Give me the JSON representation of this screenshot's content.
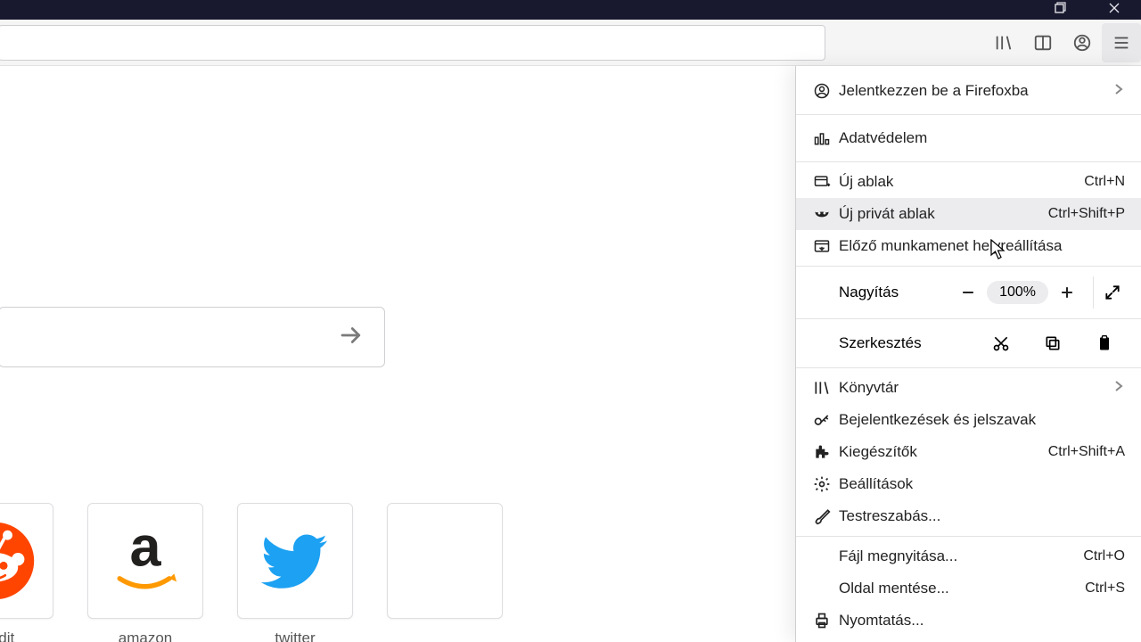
{
  "toolbar": {
    "urlbar_value": ""
  },
  "menu": {
    "signin": "Jelentkezzen be a Firefoxba",
    "privacy": "Adatvédelem",
    "new_window": "Új ablak",
    "new_window_sc": "Ctrl+N",
    "new_private": "Új privát ablak",
    "new_private_sc": "Ctrl+Shift+P",
    "restore": "Előző munkamenet helyreállítása",
    "zoom_label": "Nagyítás",
    "zoom_value": "100%",
    "edit_label": "Szerkesztés",
    "library": "Könyvtár",
    "logins": "Bejelentkezések és jelszavak",
    "addons": "Kiegészítők",
    "addons_sc": "Ctrl+Shift+A",
    "settings": "Beállítások",
    "customize": "Testreszabás...",
    "open_file": "Fájl megnyitása...",
    "open_file_sc": "Ctrl+O",
    "save_page": "Oldal mentése...",
    "save_page_sc": "Ctrl+S",
    "print": "Nyomtatás..."
  },
  "tiles": {
    "reddit": "reddit",
    "amazon": "amazon",
    "twitter": "twitter"
  }
}
